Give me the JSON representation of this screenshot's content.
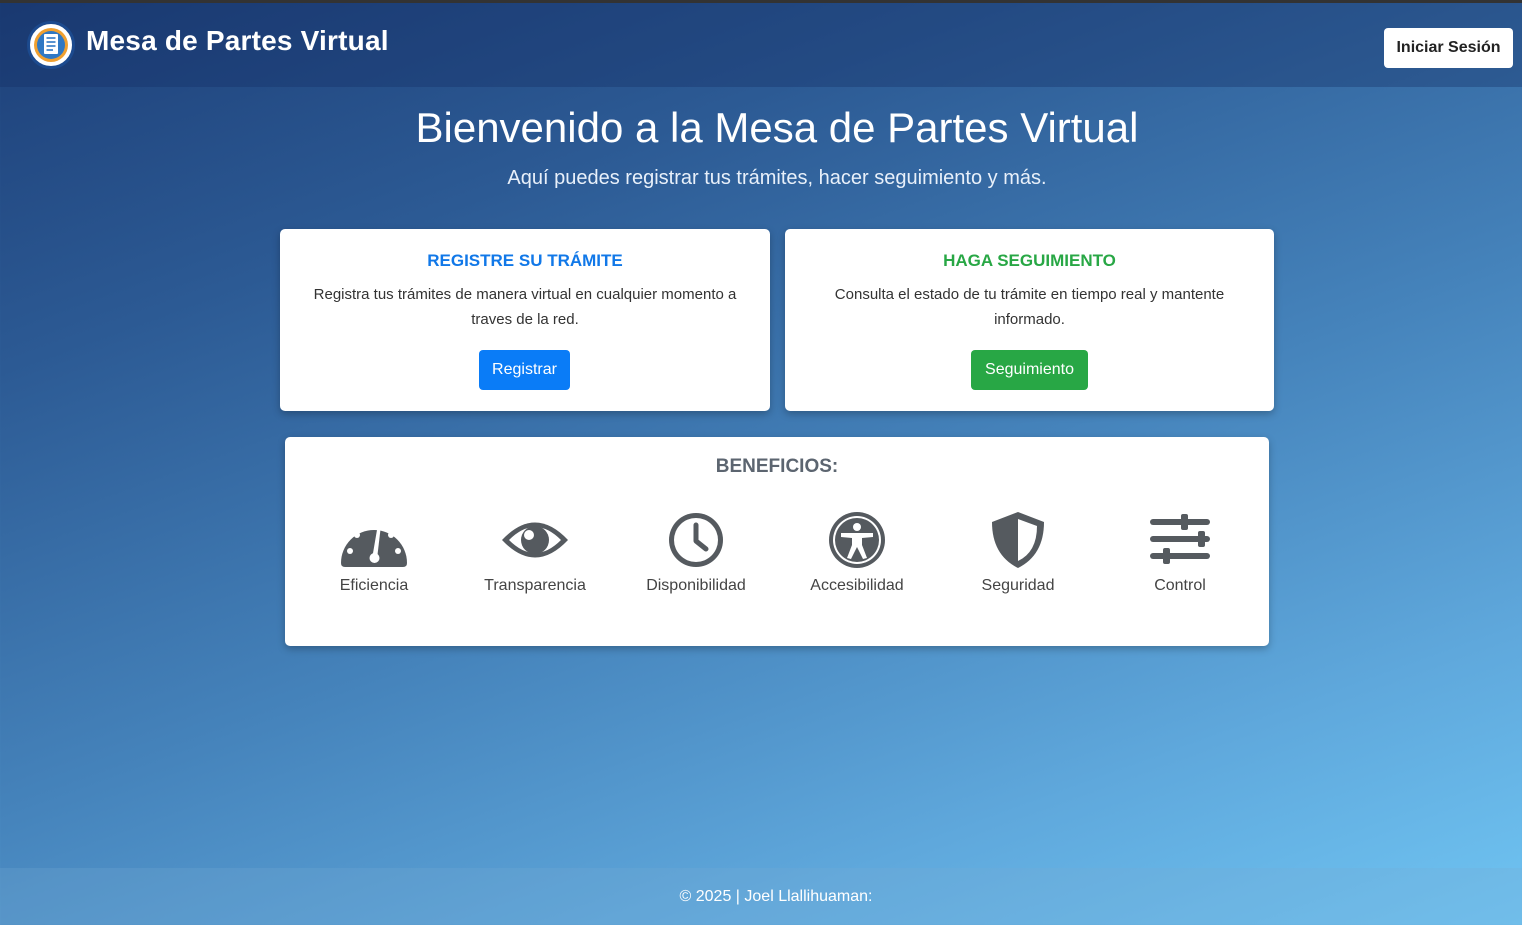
{
  "header": {
    "brand": "Mesa de Partes Virtual",
    "login_label": "Iniciar Sesión"
  },
  "hero": {
    "title": "Bienvenido a la Mesa de Partes Virtual",
    "subtitle": "Aquí puedes registrar tus trámites, hacer seguimiento y más."
  },
  "cards": [
    {
      "title": "REGISTRE SU TRÁMITE",
      "text": "Registra tus trámites de manera virtual en cualquier momento a traves de la red.",
      "button": "Registrar",
      "color": "#1178e8"
    },
    {
      "title": "HAGA SEGUIMIENTO",
      "text": "Consulta el estado de tu trámite en tiempo real y mantente informado.",
      "button": "Seguimiento",
      "color": "#28a745"
    }
  ],
  "benefits": {
    "title": "BENEFICIOS:",
    "items": [
      {
        "label": "Eficiencia",
        "icon": "speedometer-icon"
      },
      {
        "label": "Transparencia",
        "icon": "eye-icon"
      },
      {
        "label": "Disponibilidad",
        "icon": "clock-icon"
      },
      {
        "label": "Accesibilidad",
        "icon": "accessibility-icon"
      },
      {
        "label": "Seguridad",
        "icon": "shield-icon"
      },
      {
        "label": "Control",
        "icon": "sliders-icon"
      }
    ]
  },
  "footer": {
    "text": "© 2025 | Joel Llallihuaman:"
  }
}
